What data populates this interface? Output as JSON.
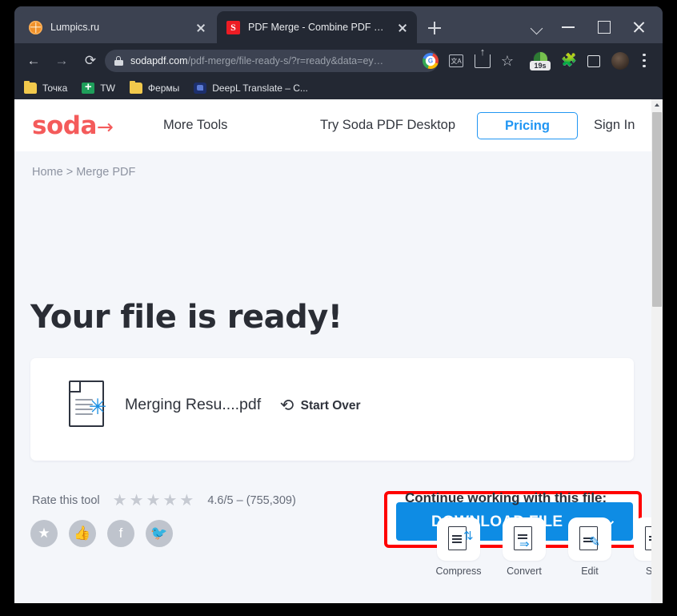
{
  "browser": {
    "tabs": [
      {
        "title": "Lumpics.ru",
        "favicon": "orange-citrus-icon",
        "active": false
      },
      {
        "title": "PDF Merge - Combine PDF Files",
        "favicon": "soda-pdf-icon",
        "active": true
      }
    ],
    "new_tab_label": "+",
    "window_controls": {
      "tab_search": "tab-search-chevron",
      "minimize": "minimize",
      "maximize": "maximize",
      "close": "close"
    },
    "toolbar": {
      "back": "←",
      "forward": "→",
      "reload": "⟳",
      "url_domain": "sodapdf.com",
      "url_path": "/pdf-merge/file-ready-s/?r=ready&data=ey…",
      "icons": [
        "google-icon",
        "translate-icon",
        "share-icon",
        "bookmark-star-icon",
        "speed-extension-icon",
        "extensions-puzzle-icon",
        "side-panel-icon",
        "profile-avatar-icon",
        "chrome-menu-icon"
      ],
      "speed_badge": "19s",
      "translate_glyph": "文A"
    },
    "bookmarks": [
      {
        "label": "Точка",
        "icon": "folder-icon"
      },
      {
        "label": "TW",
        "icon": "sheets-icon"
      },
      {
        "label": "Фермы",
        "icon": "folder-icon"
      },
      {
        "label": "DeepL Translate – C...",
        "icon": "deepl-icon"
      }
    ]
  },
  "site": {
    "logo": "soda",
    "logo_arrow": "→",
    "nav": {
      "more_tools": "More Tools",
      "desktop": "Try Soda PDF Desktop",
      "pricing": "Pricing",
      "sign_in": "Sign In"
    },
    "breadcrumb": "Home > Merge PDF",
    "page_title": "Your file is ready!",
    "file_card": {
      "file_icon": "pdf-document-sparkle-icon",
      "file_name": "Merging Resu....pdf",
      "start_over_icon": "reload-arrow-icon",
      "start_over_label": "Start Over",
      "download_label": "DOWNLOAD FILE",
      "download_caret": "chevron-down-icon"
    },
    "rating": {
      "label": "Rate this tool",
      "stars": [
        "★",
        "★",
        "★",
        "★",
        "★"
      ],
      "value": "4.6/5 – (755,309)"
    },
    "social": [
      {
        "name": "favorite-button",
        "glyph": "★"
      },
      {
        "name": "like-button",
        "glyph": "👍"
      },
      {
        "name": "facebook-button",
        "glyph": "f"
      },
      {
        "name": "twitter-button",
        "glyph": "🐦"
      }
    ],
    "continue": {
      "title": "Continue working with this file:",
      "tools": [
        {
          "label": "Compress",
          "icon": "compress-document-icon",
          "accent": "⇅"
        },
        {
          "label": "Convert",
          "icon": "convert-document-icon",
          "accent": "⇒"
        },
        {
          "label": "Edit",
          "icon": "edit-document-icon",
          "accent": "✎"
        },
        {
          "label": "Split",
          "icon": "split-document-icon",
          "accent": "→"
        }
      ]
    }
  },
  "colors": {
    "brand_red": "#f45b5b",
    "accent_blue": "#0e8ce4",
    "annotation_red": "#ff0000",
    "page_bg": "#f4f6fa",
    "chrome_dark": "#232833",
    "tab_strip": "#3c4251"
  }
}
